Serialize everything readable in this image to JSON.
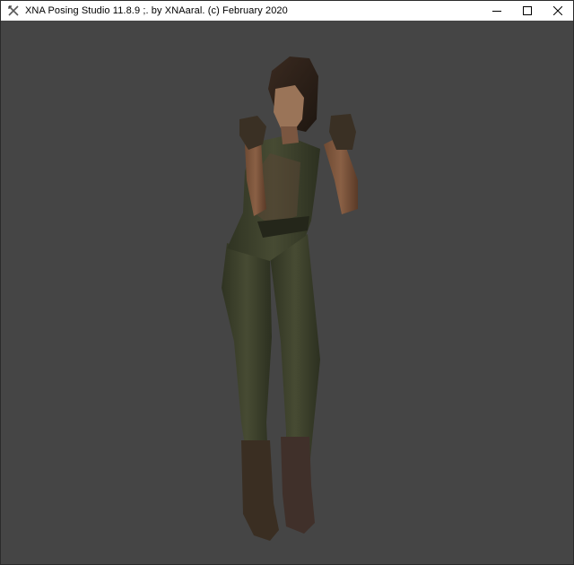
{
  "window": {
    "title": "XNA Posing Studio 11.8.9 ;.  by XNAaral. (c) February 2020",
    "controls": {
      "minimize_icon": "minimize-icon",
      "maximize_icon": "maximize-icon",
      "close_icon": "close-icon"
    }
  },
  "viewport": {
    "background": "#454545",
    "content": "3d-character-model"
  }
}
